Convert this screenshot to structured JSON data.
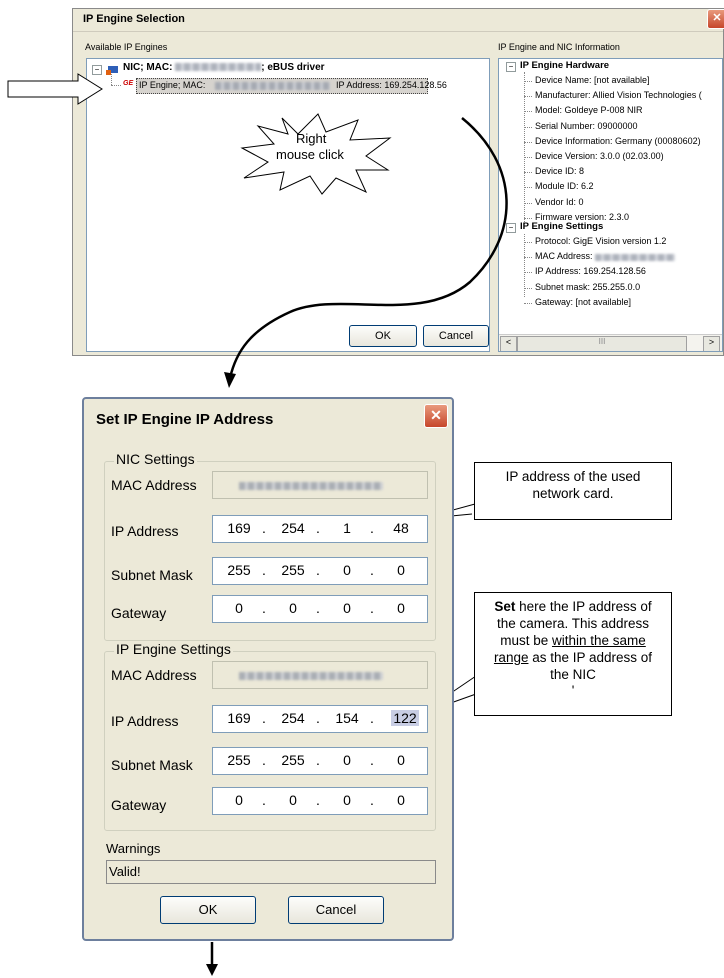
{
  "selection_window": {
    "title": "IP Engine Selection",
    "left_panel_label": "Available IP Engines",
    "right_panel_label": "IP Engine and NIC Information",
    "nic_node": {
      "prefix": "NIC; MAC:",
      "suffix": "; eBUS driver"
    },
    "engine_node": {
      "prefix": "IP Engine; MAC:",
      "ip_label": "IP Address: 169.254.128.56"
    },
    "ok_label": "OK",
    "cancel_label": "Cancel",
    "info_tree": {
      "hardware_header": "IP Engine Hardware",
      "hardware_items": [
        "Device Name: [not available]",
        "Manufacturer: Allied Vision Technologies (",
        "Model: Goldeye P-008 NIR",
        "Serial Number: 09000000",
        "Device Information: Germany (00080602)",
        "Device Version: 3.0.0 (02.03.00)",
        "Device ID: 8",
        "Module ID: 6.2",
        "Vendor Id: 0",
        "Firmware version: 2.3.0"
      ],
      "settings_header": "IP Engine Settings",
      "settings_items": [
        "Protocol: GigE Vision version 1.2",
        "MAC Address:",
        "IP Address: 169.254.128.56",
        "Subnet mask: 255.255.0.0",
        "Gateway: [not available]"
      ]
    },
    "scrollbar": {
      "left": "<",
      "mid": "III",
      "right": ">"
    }
  },
  "starburst_text": [
    "Right",
    "mouse click"
  ],
  "dialog": {
    "title": "Set IP Engine IP Address",
    "close_glyph": "✕",
    "nic_group_label": "NIC Settings",
    "ip_engine_group_label": "IP Engine Settings",
    "field_labels": {
      "mac": "MAC Address",
      "ip": "IP Address",
      "subnet": "Subnet Mask",
      "gateway": "Gateway"
    },
    "nic": {
      "ip": [
        "169",
        "254",
        "1",
        "48"
      ],
      "subnet": [
        "255",
        "255",
        "0",
        "0"
      ],
      "gateway": [
        "0",
        "0",
        "0",
        "0"
      ]
    },
    "engine": {
      "ip": [
        "169",
        "254",
        "154",
        "122"
      ],
      "subnet": [
        "255",
        "255",
        "0",
        "0"
      ],
      "gateway": [
        "0",
        "0",
        "0",
        "0"
      ]
    },
    "dot": ".",
    "warnings_label": "Warnings",
    "warnings_value": "Valid!",
    "ok_label": "OK",
    "cancel_label": "Cancel"
  },
  "callout_nic": "IP address of the used network card.",
  "callout_engine": {
    "bold": "Set",
    "line1": " here the IP address of the camera. This address must be ",
    "underlined": "within the same range",
    "line2": " as the IP address of the NIC",
    "cut": "'"
  }
}
